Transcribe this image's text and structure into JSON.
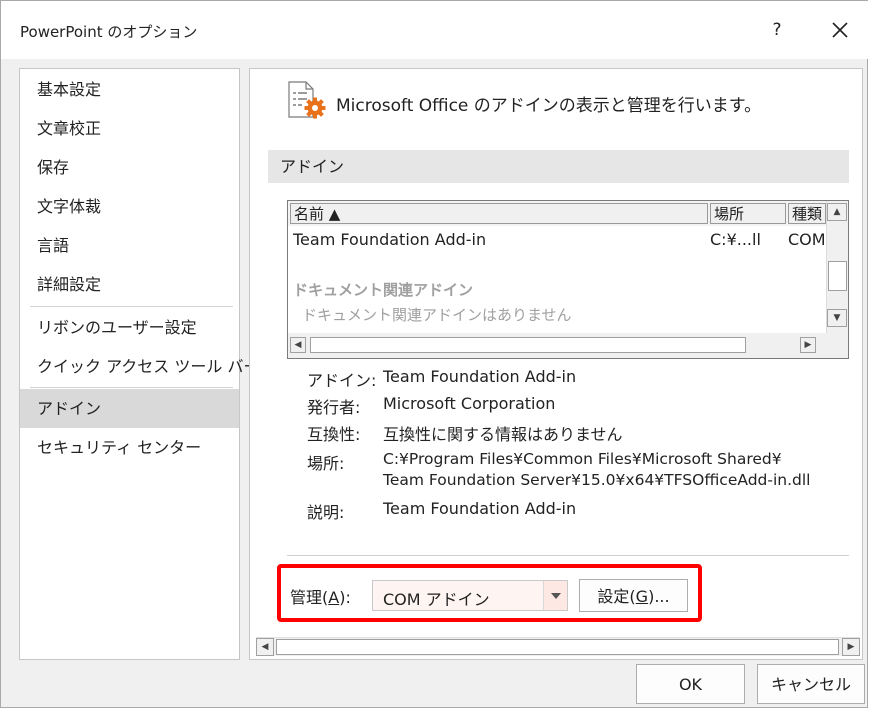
{
  "window": {
    "title": "PowerPoint のオプション",
    "help_label": "?"
  },
  "sidebar": {
    "items": [
      {
        "label": "基本設定",
        "selected": false
      },
      {
        "label": "文章校正",
        "selected": false
      },
      {
        "label": "保存",
        "selected": false
      },
      {
        "label": "文字体裁",
        "selected": false
      },
      {
        "label": "言語",
        "selected": false
      },
      {
        "label": "詳細設定",
        "selected": false
      },
      {
        "label": "リボンのユーザー設定",
        "selected": false
      },
      {
        "label": "クイック アクセス ツール バー",
        "selected": false
      },
      {
        "label": "アドイン",
        "selected": true
      },
      {
        "label": "セキュリティ センター",
        "selected": false
      }
    ]
  },
  "main": {
    "header": "Microsoft Office のアドインの表示と管理を行います。",
    "section_title": "アドイン",
    "list": {
      "columns": [
        "名前 ▲",
        "場所",
        "種類"
      ],
      "rows": [
        {
          "name": "Team Foundation Add-in",
          "location": "C:¥...ll",
          "type": "COM"
        }
      ],
      "group_label": "ドキュメント関連アドイン",
      "group_empty": "ドキュメント関連アドインはありません"
    },
    "details": {
      "addin_label": "アドイン:",
      "addin_value": "Team Foundation Add-in",
      "publisher_label": "発行者:",
      "publisher_value": "Microsoft Corporation",
      "compat_label": "互換性:",
      "compat_value": "互換性に関する情報はありません",
      "location_label": "場所:",
      "location_value_1": "C:¥Program Files¥Common Files¥Microsoft Shared¥",
      "location_value_2": "Team Foundation Server¥15.0¥x64¥TFSOfficeAdd-in.dll",
      "desc_label": "説明:",
      "desc_value": "Team Foundation Add-in"
    },
    "manage": {
      "label_pre": "管理(",
      "label_key": "A",
      "label_post": "):",
      "selected": "COM アドイン",
      "go_pre": "設定(",
      "go_key": "G",
      "go_post": ")..."
    }
  },
  "footer": {
    "ok_label": "OK",
    "cancel_label": "キャンセル"
  },
  "colors": {
    "highlight": "#ff0000",
    "selected_nav": "#d9d9d9",
    "icon_orange": "#e8711c"
  }
}
